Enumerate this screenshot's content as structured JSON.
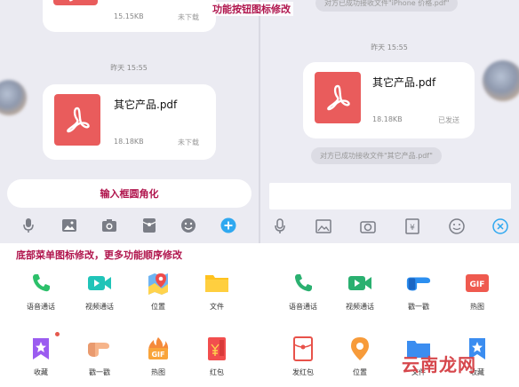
{
  "annotations": {
    "function_button": "功能按钮图标修改",
    "input_box": "输入框圆角化",
    "bottom_menu": "底部菜单图标修改，更多功能顺序修改"
  },
  "left_chat": {
    "top_file": {
      "size": "15.15KB",
      "status": "未下载"
    },
    "timestamp": "昨天 15:55",
    "file": {
      "name": "其它产品.pdf",
      "size": "18.18KB",
      "status": "未下载"
    }
  },
  "right_chat": {
    "top_system_msg": "对方已成功接收文件\"iPhone 价格.pdf\"",
    "timestamp": "昨天 15:55",
    "file": {
      "name": "其它产品.pdf",
      "size": "18.18KB",
      "status": "已发送"
    },
    "system_msg": "对方已成功接收文件\"其它产品.pdf\""
  },
  "left_menu": {
    "row1": [
      {
        "label": "语音通话",
        "icon": "phone-icon"
      },
      {
        "label": "视频通话",
        "icon": "video-icon"
      },
      {
        "label": "位置",
        "icon": "map-pin-icon"
      },
      {
        "label": "文件",
        "icon": "folder-icon"
      }
    ],
    "row2": [
      {
        "label": "收藏",
        "icon": "favorite-star-icon"
      },
      {
        "label": "戳一戳",
        "icon": "poke-finger-icon"
      },
      {
        "label": "热图",
        "icon": "gif-icon"
      },
      {
        "label": "红包",
        "icon": "red-packet-icon"
      }
    ]
  },
  "right_menu": {
    "row1": [
      {
        "label": "语音通话",
        "icon": "phone-icon"
      },
      {
        "label": "视频通话",
        "icon": "video-icon"
      },
      {
        "label": "戳一戳",
        "icon": "poke-finger-icon"
      },
      {
        "label": "热图",
        "icon": "gif-icon"
      }
    ],
    "row2": [
      {
        "label": "发红包",
        "icon": "red-packet-icon"
      },
      {
        "label": "位置",
        "icon": "map-pin-icon"
      },
      {
        "label": "文件",
        "icon": "folder-icon"
      },
      {
        "label": "收藏",
        "icon": "favorite-star-icon"
      }
    ]
  },
  "icon_glyphs": {
    "gif": "GIF"
  },
  "watermark": "云南龙网",
  "colors": {
    "annotation": "#b0154d",
    "pdf_red": "#e95c5c",
    "accent_blue": "#2fa8f0",
    "green": "#2cc06a",
    "teal": "#20c4b8"
  }
}
